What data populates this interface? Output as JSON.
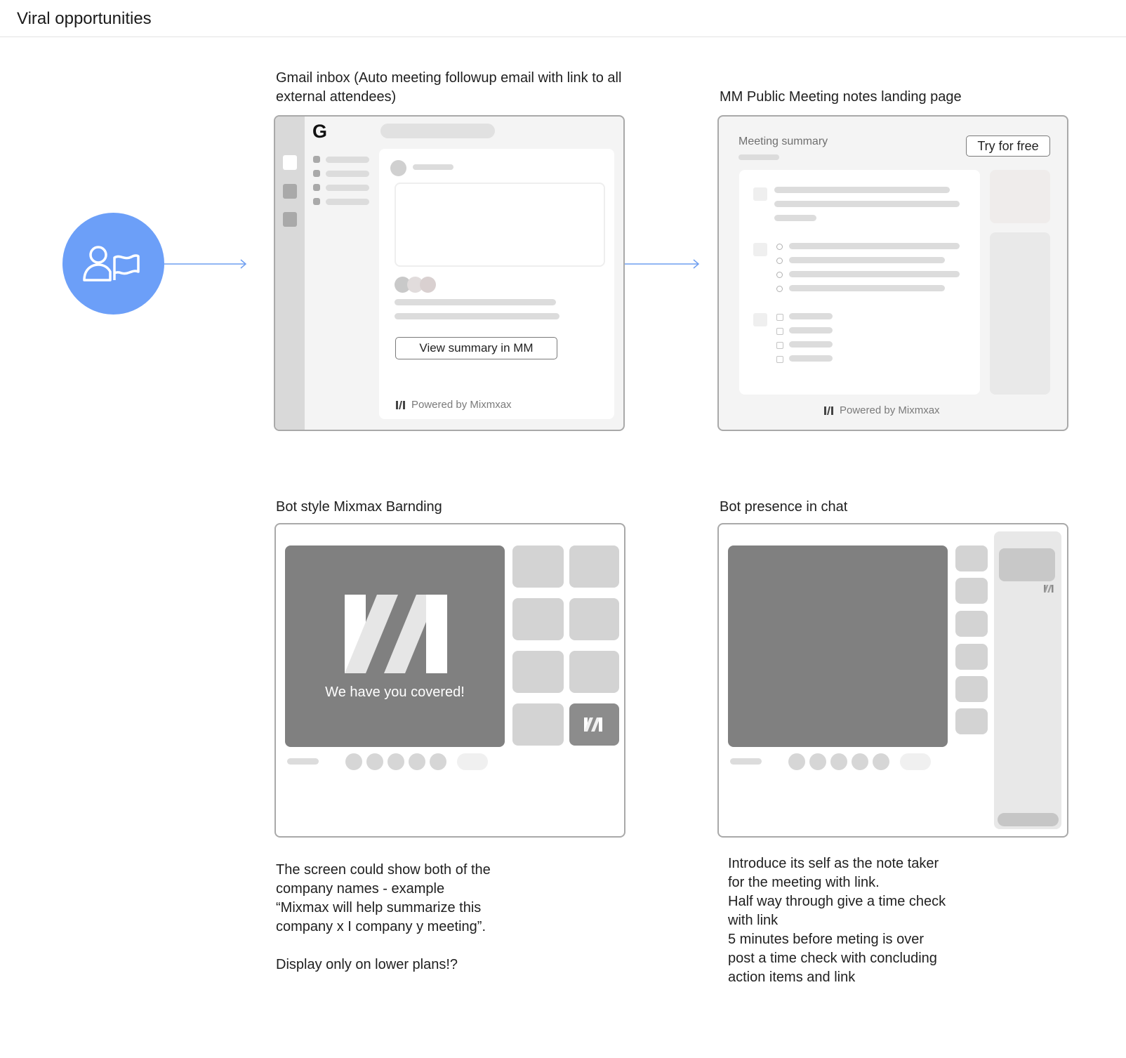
{
  "header": {
    "title": "Viral opportunities"
  },
  "panels": {
    "gmail": {
      "title": "Gmail inbox (Auto meeting followup email with link to all external attendees)",
      "logo": "G",
      "cta": "View summary in MM",
      "powered_by": "Powered by Mixmxax"
    },
    "landing": {
      "title": "MM Public Meeting notes landing page",
      "heading": "Meeting summary",
      "cta": "Try for free",
      "powered_by": "Powered by Mixmxax"
    },
    "bot": {
      "title": "Bot style Mixmax Barnding",
      "video_caption": "We have you covered!"
    },
    "chat": {
      "title": "Bot presence in chat"
    }
  },
  "notes": {
    "bot": "The screen could show both of the\ncompany names - example\n“Mixmax will help summarize this\ncompany x I company y meeting”.\n\nDisplay only on lower plans!?",
    "chat": "Introduce its self as the note taker\nfor the meeting with link.\nHalf way through give a time check\nwith link\n5 minutes before meting is over\npost a time check with concluding\naction items and link"
  },
  "icons": {
    "persona": "user-flag-icon",
    "mixmax": "mixmax-logo-icon",
    "arrow": "arrow-right-icon"
  },
  "colors": {
    "accent": "#6c9ff8",
    "arrow": "#6f9ff0",
    "video": "#808080",
    "tile": "#d3d3d3"
  }
}
